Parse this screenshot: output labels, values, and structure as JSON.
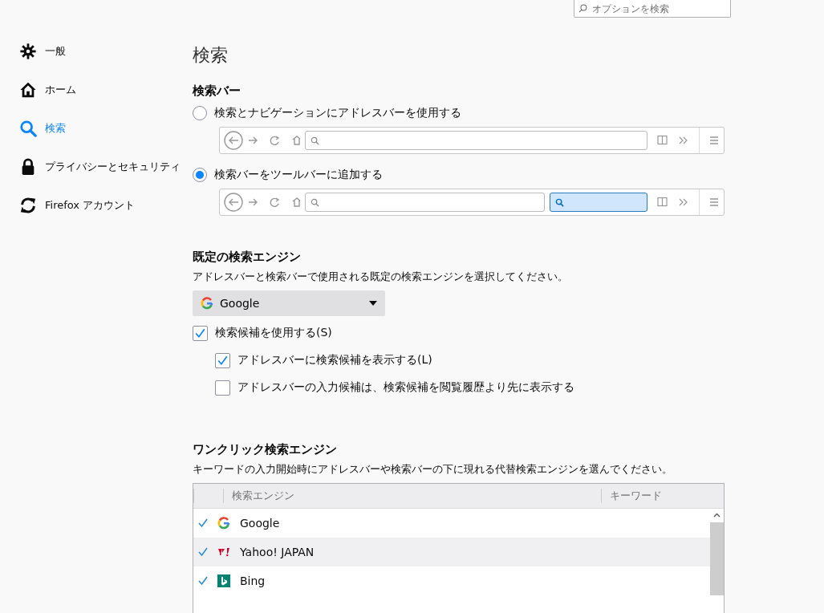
{
  "search_options": {
    "placeholder": "オプションを検索"
  },
  "sidebar": {
    "items": [
      {
        "label": "一般",
        "kind": "gear",
        "selected": false
      },
      {
        "label": "ホーム",
        "kind": "home",
        "selected": false
      },
      {
        "label": "検索",
        "kind": "search",
        "selected": true
      },
      {
        "label": "プライバシーとセキュリティ",
        "kind": "lock",
        "selected": false
      },
      {
        "label": "Firefox アカウント",
        "kind": "sync",
        "selected": false
      }
    ]
  },
  "page_title": "検索",
  "search_bar": {
    "heading": "検索バー",
    "options": [
      {
        "label": "検索とナビゲーションにアドレスバーを使用する",
        "selected": false,
        "preview_search_box": false
      },
      {
        "label": "検索バーをツールバーに追加する",
        "selected": true,
        "preview_search_box": true
      }
    ]
  },
  "default_engine": {
    "heading": "既定の検索エンジン",
    "description": "アドレスバーと検索バーで使用される既定の検索エンジンを選択してください。",
    "dropdown": {
      "value": "Google"
    },
    "checkboxes": [
      {
        "label": "検索候補を使用する(S)",
        "checked": true,
        "indented": false
      },
      {
        "label": "アドレスバーに検索候補を表示する(L)",
        "checked": true,
        "indented": true
      },
      {
        "label": "アドレスバーの入力候補は、検索候補を閲覧履歴より先に表示する",
        "checked": false,
        "indented": true
      }
    ]
  },
  "one_click": {
    "heading": "ワンクリック検索エンジン",
    "description": "キーワードの入力開始時にアドレスバーや検索バーの下に現れる代替検索エンジンを選んでください。",
    "table": {
      "columns": [
        "検索エンジン",
        "キーワード"
      ],
      "rows": [
        {
          "name": "Google",
          "kind": "google",
          "checked": true,
          "selected": false
        },
        {
          "name": "Yahoo! JAPAN",
          "kind": "yahoo",
          "checked": true,
          "selected": true
        },
        {
          "name": "Bing",
          "kind": "bing",
          "checked": true,
          "selected": false
        }
      ]
    }
  }
}
